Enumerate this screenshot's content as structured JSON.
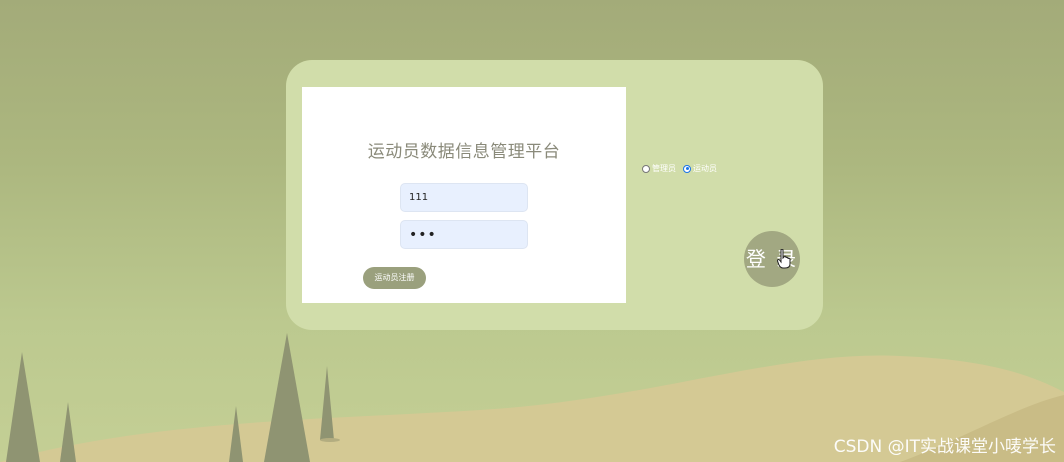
{
  "colors": {
    "background": "#a3ab79",
    "card": "#d1ddaa",
    "panel": "#ffffff",
    "accent_button": "#9aa07d",
    "login_button": "#a2a882",
    "hill": "#d4c994",
    "tree": "#8f9472",
    "input": "#e8f0fe"
  },
  "login_form": {
    "title": "运动员数据信息管理平台",
    "username_value": "111",
    "password_value": "•••",
    "register_label": "运动员注册"
  },
  "roles": [
    {
      "label": "管理员",
      "checked": false
    },
    {
      "label": "运动员",
      "checked": true
    }
  ],
  "login_button_label": "登 录",
  "watermark": "CSDN @IT实战课堂小唛学长",
  "icons": [
    "radio-icon",
    "hand-cursor-icon",
    "tree-icon"
  ]
}
